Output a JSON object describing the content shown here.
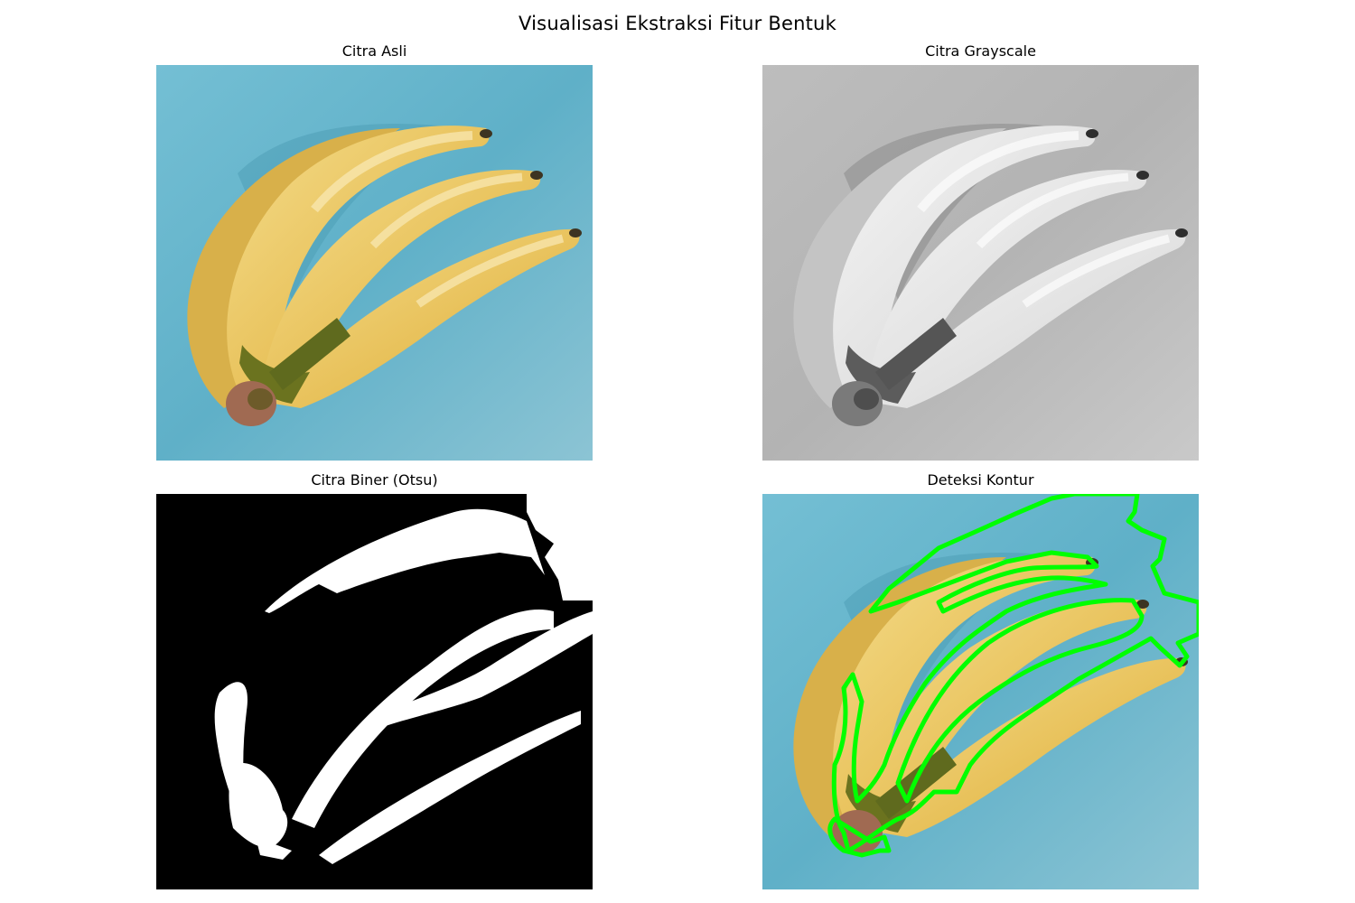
{
  "figure": {
    "title": "Visualisasi Ekstraksi Fitur Bentuk"
  },
  "panels": [
    {
      "title": "Citra Asli",
      "content": "banana-photo-color"
    },
    {
      "title": "Citra Grayscale",
      "content": "banana-photo-grayscale"
    },
    {
      "title": "Citra Biner (Otsu)",
      "content": "binary-mask"
    },
    {
      "title": "Deteksi Kontur",
      "content": "banana-photo-with-contours"
    }
  ],
  "colors": {
    "background_blue": "#67b4c8",
    "banana_yellow": "#e9c45e",
    "banana_highlight": "#f8e7ad",
    "stem_green": "#5f6a1e",
    "stem_brown": "#a06a52",
    "contour_green": "#00ff00",
    "binary_black": "#000000",
    "binary_white": "#ffffff"
  }
}
